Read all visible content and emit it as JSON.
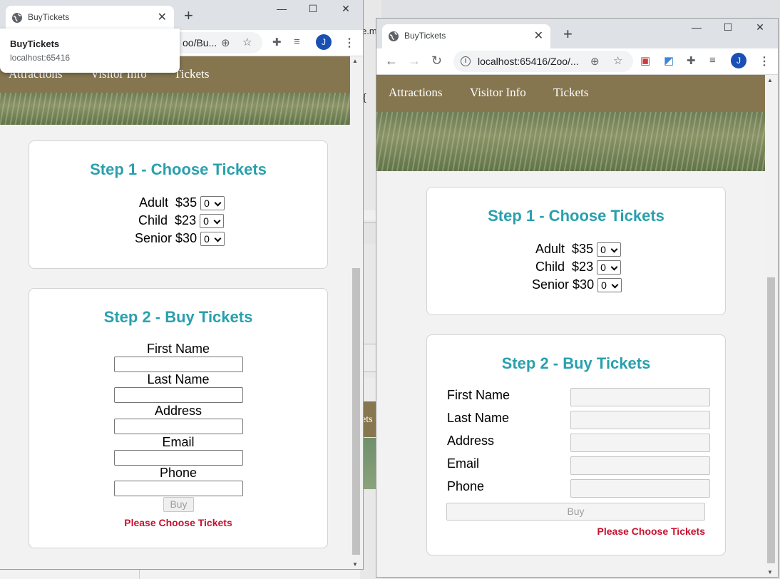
{
  "window_left": {
    "tab_title": "BuyTickets",
    "url": "oo/Bu...",
    "popup_title": "BuyTickets",
    "popup_url": "localhost:65416",
    "avatar_letter": "J"
  },
  "window_right": {
    "tab_title": "BuyTickets",
    "url": "localhost:65416/Zoo/...",
    "avatar_letter": "J"
  },
  "window_controls": {
    "minimize": "—",
    "maximize": "☐",
    "close": "✕"
  },
  "new_tab_symbol": "+",
  "site": {
    "nav": [
      "Attractions",
      "Visitor Info",
      "Tickets"
    ],
    "step1_title": "Step 1 - Choose Tickets",
    "tickets": [
      {
        "label": "Adult",
        "price": "$35",
        "qty": "0"
      },
      {
        "label": "Child",
        "price": "$23",
        "qty": "0"
      },
      {
        "label": "Senior",
        "price": "$30",
        "qty": "0"
      }
    ],
    "step2_title": "Step 2 - Buy Tickets",
    "fields": [
      "First Name",
      "Last Name",
      "Address",
      "Email",
      "Phone"
    ],
    "buy_label": "Buy",
    "error": "Please Choose Tickets"
  },
  "background": {
    "fragment_top": "e.m",
    "fragment_brace": "{",
    "fragment_nav": "ets"
  },
  "colors": {
    "nav": "#857650",
    "heading": "#2aa0ad",
    "error": "#c8102e",
    "avatar": "#1a4fb4"
  },
  "icons": [
    "globe-icon",
    "close-icon",
    "back-icon",
    "forward-icon",
    "reload-icon",
    "info-icon",
    "zoom-icon",
    "star-icon",
    "extensions-icon",
    "media-icon",
    "menu-icon"
  ]
}
